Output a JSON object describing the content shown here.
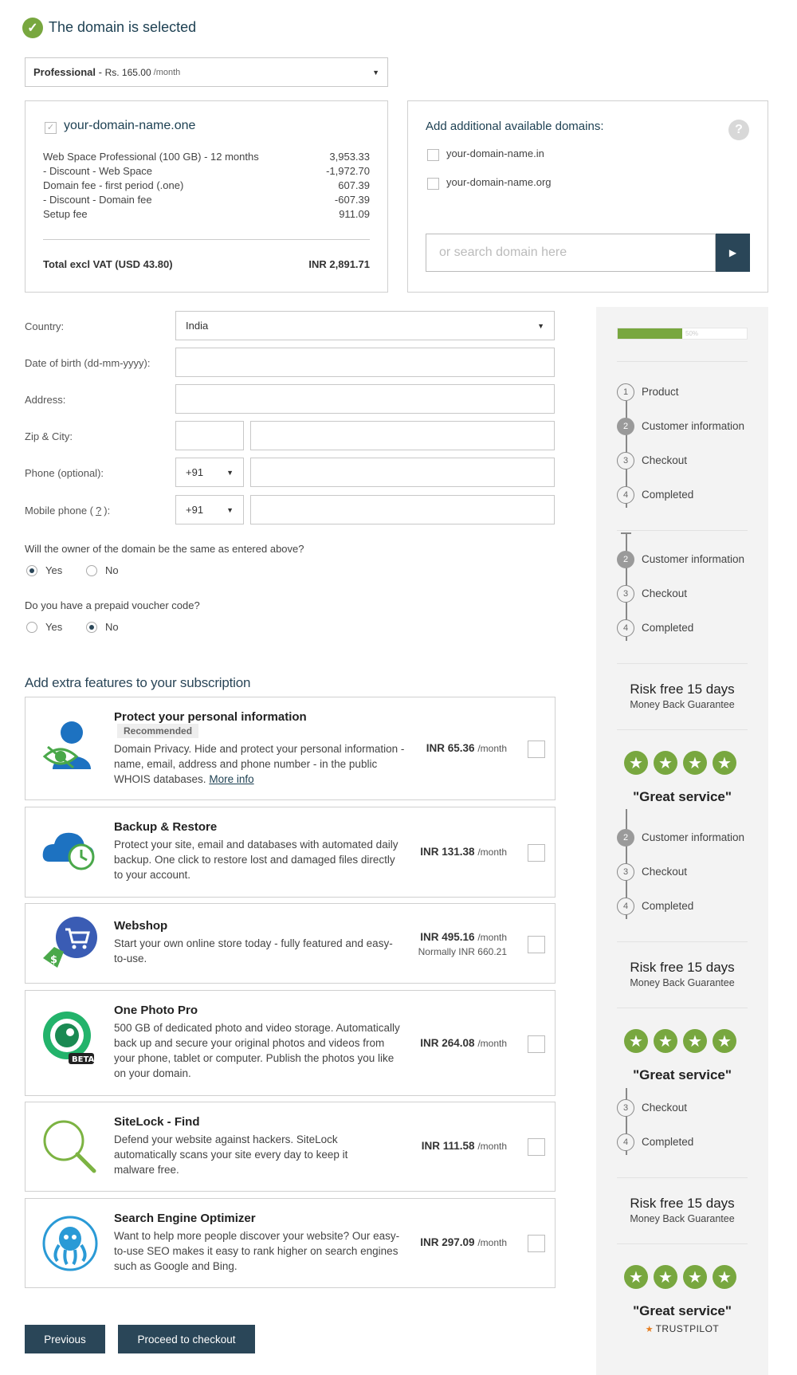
{
  "header": {
    "title": "The domain is selected"
  },
  "plan": {
    "name": "Professional",
    "sep": " - ",
    "price": "Rs. 165.00",
    "period": "/month"
  },
  "summary": {
    "domain": "your-domain-name.one",
    "lines": [
      {
        "label": "Web Space Professional (100 GB) - 12 months",
        "value": "3,953.33"
      },
      {
        "label": "- Discount - Web Space",
        "value": "-1,972.70"
      },
      {
        "label": "Domain fee - first period (.one)",
        "value": "607.39"
      },
      {
        "label": "- Discount - Domain fee",
        "value": "-607.39"
      },
      {
        "label": "Setup fee",
        "value": "911.09"
      }
    ],
    "total_label": "Total excl VAT (USD 43.80)",
    "total_value": "INR 2,891.71"
  },
  "additional": {
    "title": "Add additional available domains:",
    "help": "?",
    "domains": [
      "your-domain-name.in",
      "your-domain-name.org"
    ],
    "search_placeholder": "or search domain here"
  },
  "form": {
    "country_label": "Country:",
    "country_value": "India",
    "dob_label": "Date of birth (dd-mm-yyyy):",
    "address_label": "Address:",
    "zip_label": "Zip & City:",
    "phone_label": "Phone (optional):",
    "phone_code": "+91",
    "mobile_label_pre": "Mobile phone (",
    "mobile_label_q": "?",
    "mobile_label_post": "):",
    "mobile_code": "+91",
    "owner_question": "Will the owner of the domain be the same as entered above?",
    "owner_yes": "Yes",
    "owner_no": "No",
    "voucher_question": "Do you have a prepaid voucher code?",
    "voucher_yes": "Yes",
    "voucher_no": "No"
  },
  "extras": {
    "title": "Add extra features to your subscription",
    "items": [
      {
        "title": "Protect your personal information",
        "badge": "Recommended",
        "desc": "Domain Privacy. Hide and protect your personal information - name, email, address and phone number - in the public WHOIS databases.",
        "link": "More info",
        "price": "INR 65.36",
        "per": "/month",
        "icon": "privacy-icon"
      },
      {
        "title": "Backup & Restore",
        "desc": "Protect your site, email and databases with automated daily backup. One click to restore lost and damaged files directly to your account.",
        "price": "INR 131.38",
        "per": "/month",
        "icon": "backup-cloud-icon"
      },
      {
        "title": "Webshop",
        "desc": "Start your own online store today - fully featured and easy-to-use.",
        "price": "INR 495.16",
        "per": "/month",
        "normally": "Normally INR 660.21",
        "icon": "shopping-cart-icon"
      },
      {
        "title": "One Photo Pro",
        "desc": "500 GB of dedicated photo and video storage. Automatically back up and secure your original photos and videos from your phone, tablet or computer. Publish the photos you like on your domain.",
        "price": "INR 264.08",
        "per": "/month",
        "beta": "BETA",
        "icon": "camera-lens-icon"
      },
      {
        "title": "SiteLock - Find",
        "desc": "Defend your website against hackers. SiteLock automatically scans your site every day to keep it malware free.",
        "price": "INR 111.58",
        "per": "/month",
        "icon": "magnifier-icon"
      },
      {
        "title": "Search Engine Optimizer",
        "desc": "Want to help more people discover your website? Our easy-to-use SEO makes it easy to rank higher on search engines such as Google and Bing.",
        "price": "INR 297.09",
        "per": "/month",
        "icon": "octopus-icon"
      }
    ]
  },
  "buttons": {
    "previous": "Previous",
    "proceed": "Proceed to checkout"
  },
  "sidebar": {
    "progress": 0.5,
    "progress_text": "50%",
    "steps": [
      {
        "n": "1",
        "label": "Product"
      },
      {
        "n": "2",
        "label": "Customer information"
      },
      {
        "n": "3",
        "label": "Checkout"
      },
      {
        "n": "4",
        "label": "Completed"
      }
    ],
    "risk_title": "Risk free 15 days",
    "risk_sub": "Money Back Guarantee",
    "great": "\"Great service\"",
    "trustpilot": "TRUSTPILOT",
    "colors": {
      "accent": "#78a73f",
      "dark": "#2a4658"
    }
  }
}
